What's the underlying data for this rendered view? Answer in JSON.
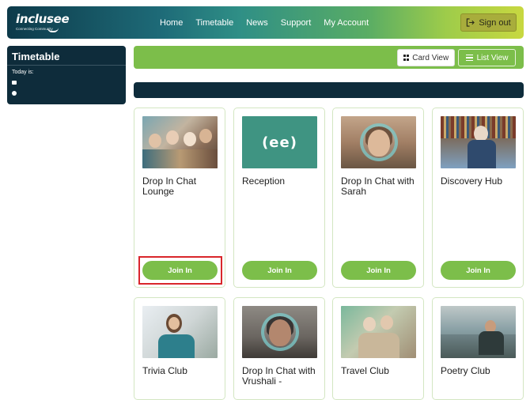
{
  "header": {
    "logo_text": "inclusee",
    "logo_tagline": "Connecting Community",
    "nav": [
      "Home",
      "Timetable",
      "News",
      "Support",
      "My Account"
    ],
    "signout_label": "Sign out"
  },
  "sidebar": {
    "title": "Timetable",
    "today_label": "Today is:"
  },
  "view_toggle": {
    "card_view_label": "Card View",
    "list_view_label": "List View"
  },
  "cards": [
    {
      "title": "Drop In Chat Lounge",
      "join_label": "Join In",
      "image": "people-group-photo"
    },
    {
      "title": "Reception",
      "join_label": "Join In",
      "image": "reception-logo",
      "logo_glyph": "(ee)"
    },
    {
      "title": "Drop In Chat with Sarah",
      "join_label": "Join In",
      "image": "portrait-in-ring"
    },
    {
      "title": "Discovery Hub",
      "join_label": "Join In",
      "image": "man-with-tablet-library"
    },
    {
      "title": "Trivia Club",
      "image": "woman-writing"
    },
    {
      "title": "Drop In Chat with Vrushali -",
      "image": "portrait-in-ring"
    },
    {
      "title": "Travel Club",
      "image": "couple-travel"
    },
    {
      "title": "Poetry Club",
      "image": "seaside-reader"
    }
  ],
  "colors": {
    "accent_green": "#7cbe4a",
    "dark_navy": "#0e2c3b",
    "highlight_red": "#d9262b"
  }
}
